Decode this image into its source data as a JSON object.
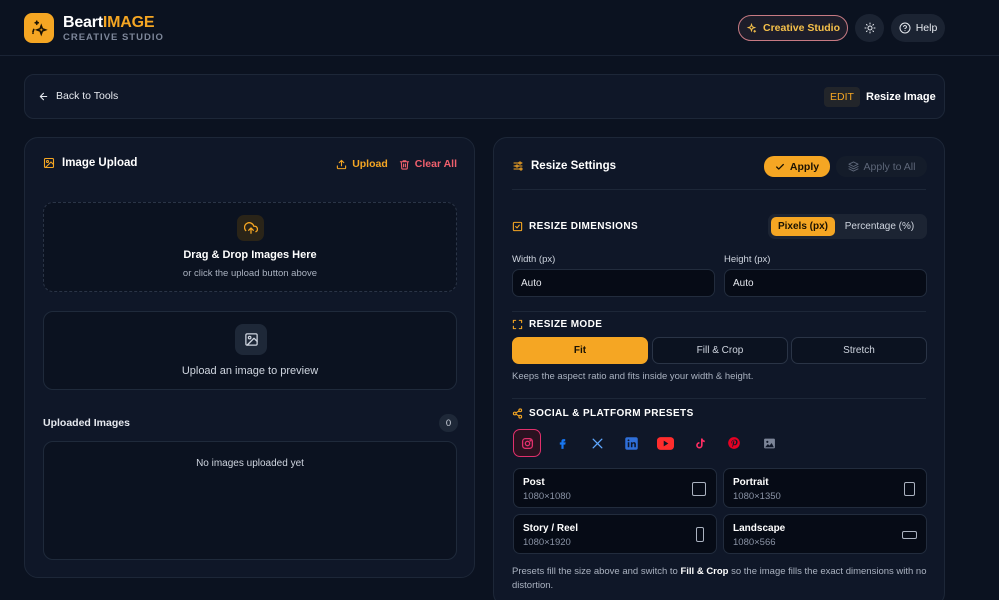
{
  "brand": {
    "name_plain": "Beart",
    "name_accent": "IMAGE",
    "tagline": "CREATIVE STUDIO"
  },
  "header": {
    "studio_label": "Creative Studio",
    "help_label": "Help"
  },
  "breadcrumb": {
    "back_label": "Back to Tools",
    "badge": "EDIT",
    "title": "Resize Image"
  },
  "upload_panel": {
    "title": "Image Upload",
    "upload_label": "Upload",
    "clear_label": "Clear All",
    "dropzone_title": "Drag & Drop Images Here",
    "dropzone_sub": "or click the upload button above",
    "preview_text": "Upload an image to preview",
    "uploaded_label": "Uploaded Images",
    "uploaded_count": "0",
    "empty_text": "No images uploaded yet"
  },
  "settings": {
    "title": "Resize Settings",
    "apply_label": "Apply",
    "apply_all_label": "Apply to All",
    "dimensions_heading": "RESIZE DIMENSIONS",
    "unit_pixels": "Pixels (px)",
    "unit_percent": "Percentage (%)",
    "width_label": "Width (px)",
    "width_value": "Auto",
    "height_label": "Height (px)",
    "height_value": "Auto",
    "mode_heading": "RESIZE MODE",
    "modes": [
      "Fit",
      "Fill & Crop",
      "Stretch"
    ],
    "mode_hint": "Keeps the aspect ratio and fits inside your width & height.",
    "presets_heading": "SOCIAL & PLATFORM PRESETS",
    "presets": [
      {
        "name": "Post",
        "dims": "1080×1080"
      },
      {
        "name": "Portrait",
        "dims": "1080×1350"
      },
      {
        "name": "Story / Reel",
        "dims": "1080×1920"
      },
      {
        "name": "Landscape",
        "dims": "1080×566"
      }
    ],
    "presets_hint_1": "Presets fill the size above and switch to ",
    "presets_hint_bold": "Fill & Crop",
    "presets_hint_2": " so the image fills the exact dimensions with no distortion."
  },
  "colors": {
    "accent": "#f5a623",
    "danger": "#f0606d",
    "background": "#0b1220",
    "panel": "#0f1728"
  },
  "icons": [
    "sparkle-icon",
    "sun-icon",
    "help-circle-icon",
    "arrow-left-icon",
    "image-icon",
    "upload-icon",
    "trash-icon",
    "cloud-upload-icon",
    "sliders-icon",
    "check-icon",
    "layers-icon",
    "resize-check-icon",
    "expand-icon",
    "share-icon",
    "instagram-icon",
    "facebook-icon",
    "x-icon",
    "linkedin-icon",
    "youtube-icon",
    "tiktok-icon",
    "pinterest-icon",
    "gallery-icon"
  ]
}
